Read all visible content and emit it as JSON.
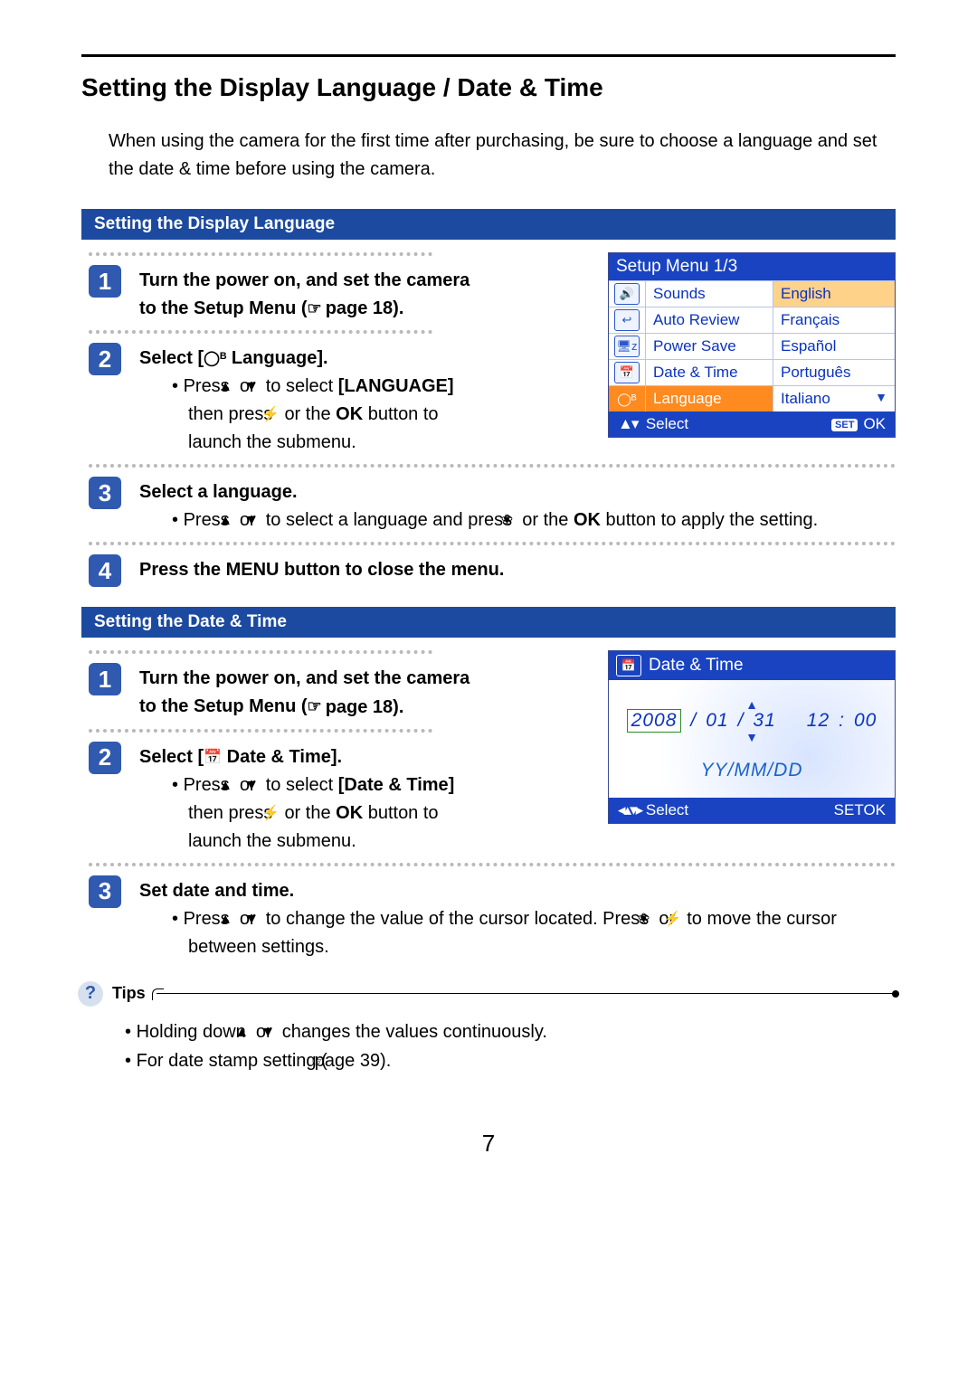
{
  "page_number": "7",
  "title": "Setting the Display Language / Date & Time",
  "intro": "When using the camera for the first time after purchasing, be sure to choose a language and set the date & time before using the camera.",
  "section1": {
    "header": "Setting the Display Language",
    "screenshot": {
      "title": "Setup Menu 1/3",
      "rows": [
        {
          "label": "Sounds",
          "value": "English",
          "highlight_value": true
        },
        {
          "label": "Auto Review",
          "value": "Français"
        },
        {
          "label": "Power Save",
          "value": "Español"
        },
        {
          "label": "Date & Time",
          "value": "Português"
        },
        {
          "label": "Language",
          "value": "Italiano",
          "selected": true,
          "down_tri": true
        }
      ],
      "footer_left": "Select",
      "footer_right": "OK",
      "footer_set": "SET"
    },
    "steps": {
      "s1_title": "Turn the power on, and set the camera to the Setup Menu (",
      "s1_page_ref": "page 18).",
      "s2_title": "Select [",
      "s2_title_b": "  Language].",
      "s2_bullet_a": "Press ",
      "s2_bullet_b": " or ",
      "s2_bullet_c": " to select ",
      "s2_bullet_lang": "[LANGUAGE]",
      "s2_bullet_d": " then press ",
      "s2_bullet_e": " or the ",
      "s2_bullet_ok": "OK",
      "s2_bullet_f": " button to launch the submenu.",
      "s3_title": "Select a language.",
      "s3_bullet_a": "Press ",
      "s3_bullet_b": " or ",
      "s3_bullet_c": " to select a language and press ",
      "s3_bullet_d": " or the ",
      "s3_bullet_ok": "OK",
      "s3_bullet_e": " button to apply the setting.",
      "s4_title": "Press the MENU button to close the menu."
    }
  },
  "section2": {
    "header": "Setting the Date & Time",
    "screenshot": {
      "title": "Date & Time",
      "year": "2008",
      "month": "01",
      "day": "31",
      "hour": "12",
      "minute": "00",
      "format": "YY/MM/DD",
      "footer_left": "Select",
      "footer_right": "OK",
      "footer_set": "SET"
    },
    "steps": {
      "s1_title": "Turn the power on, and set the camera to the Setup Menu (",
      "s1_page_ref": "page 18).",
      "s2_title": "Select [",
      "s2_title_b": "  Date & Time].",
      "s2_bullet_a": "Press ",
      "s2_bullet_b": " or ",
      "s2_bullet_c": " to select ",
      "s2_bullet_dt": "[Date & Time]",
      "s2_bullet_d": " then press ",
      "s2_bullet_e": " or the ",
      "s2_bullet_ok": "OK",
      "s2_bullet_f": " button to launch the submenu.",
      "s3_title": "Set date and time.",
      "s3_bullet_a": "Press ",
      "s3_bullet_b": " or ",
      "s3_bullet_c": " to change the value of the cursor located.   Press ",
      "s3_bullet_d": " or ",
      "s3_bullet_e": " to move the cursor between settings."
    }
  },
  "tips": {
    "label": "Tips",
    "t1_a": "Holding down ",
    "t1_b": " or ",
    "t1_c": " changes the values continuously.",
    "t2_a": "For date stamp setting (",
    "t2_b": "page 39)."
  }
}
